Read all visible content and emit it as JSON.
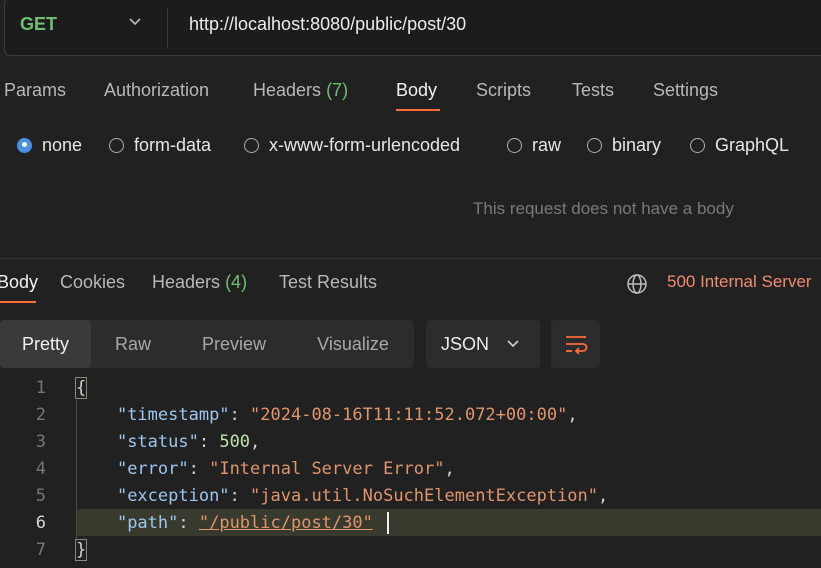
{
  "request": {
    "method": "GET",
    "url": "http://localhost:8080/public/post/30"
  },
  "request_tabs": [
    {
      "label": "Params"
    },
    {
      "label": "Authorization"
    },
    {
      "label": "Headers",
      "count": "(7)"
    },
    {
      "label": "Body"
    },
    {
      "label": "Scripts"
    },
    {
      "label": "Tests"
    },
    {
      "label": "Settings"
    }
  ],
  "body_types": [
    "none",
    "form-data",
    "x-www-form-urlencoded",
    "raw",
    "binary",
    "GraphQL"
  ],
  "body_selected": "none",
  "no_body_message": "This request does not have a body",
  "response_tabs": [
    {
      "label": "Body"
    },
    {
      "label": "Cookies"
    },
    {
      "label": "Headers",
      "count": "(4)"
    },
    {
      "label": "Test Results"
    }
  ],
  "response_status": "500 Internal Server",
  "view_modes": [
    "Pretty",
    "Raw",
    "Preview",
    "Visualize"
  ],
  "format": "JSON",
  "code": {
    "line_numbers": [
      "1",
      "2",
      "3",
      "4",
      "5",
      "6",
      "7"
    ],
    "open_brace": "{",
    "close_brace": "}",
    "fields": [
      {
        "key": "\"timestamp\"",
        "value": "\"2024-08-16T11:11:52.072+00:00\"",
        "type": "string"
      },
      {
        "key": "\"status\"",
        "value": "500",
        "type": "number"
      },
      {
        "key": "\"error\"",
        "value": "\"Internal Server Error\"",
        "type": "string"
      },
      {
        "key": "\"exception\"",
        "value": "\"java.util.NoSuchElementException\"",
        "type": "string"
      },
      {
        "key": "\"path\"",
        "value": "\"/public/post/30\"",
        "type": "string"
      }
    ]
  },
  "colors": {
    "accent": "#ff6c37",
    "method_get": "#6fbf73",
    "status_error": "#f08c72"
  }
}
